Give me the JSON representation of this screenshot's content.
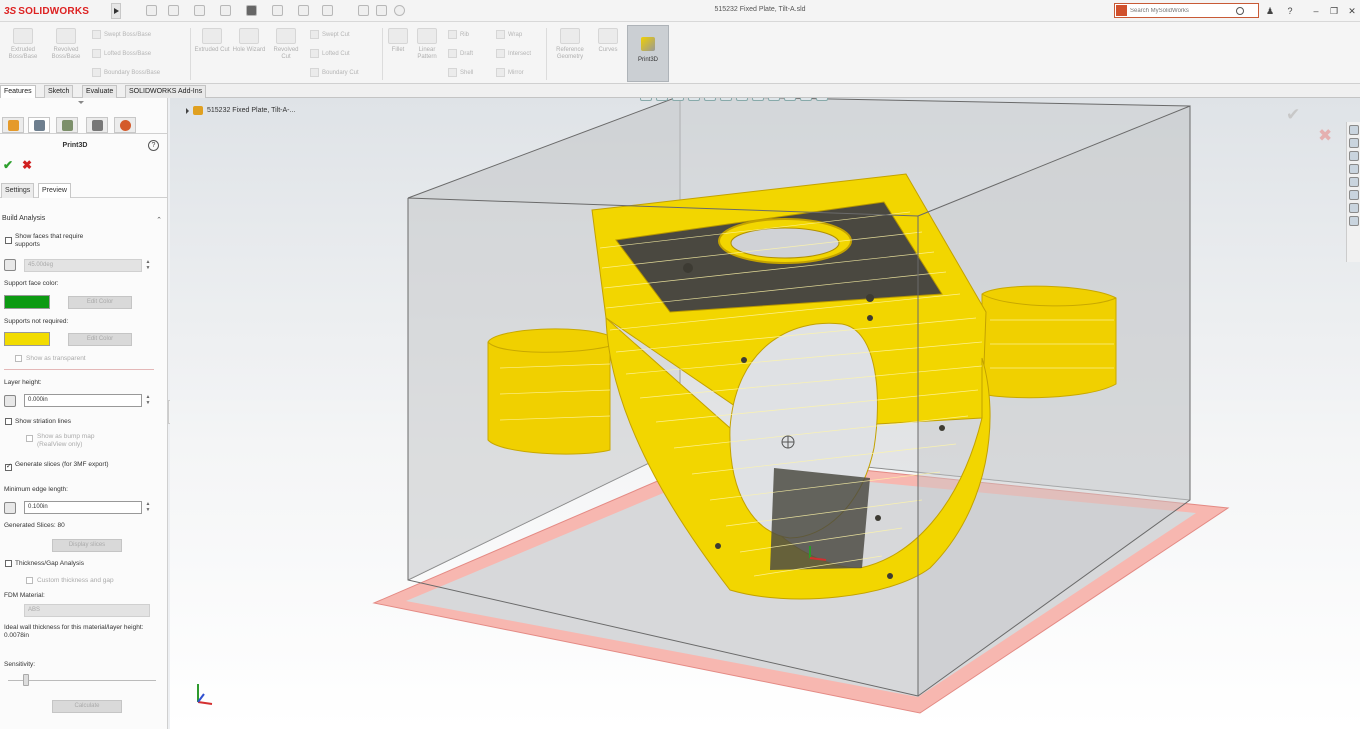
{
  "app": {
    "logo_ds": "3S",
    "logo_name": "SOLIDWORKS",
    "document_title": "515232 Fixed Plate, Tilt-A.sld",
    "search_placeholder": "Search MySolidWorks"
  },
  "command_manager": {
    "large_buttons": [
      {
        "id": "extruded-boss",
        "label": "Extruded Boss/Base"
      },
      {
        "id": "revolved-boss",
        "label": "Revolved Boss/Base"
      },
      {
        "id": "extruded-cut",
        "label": "Extruded Cut"
      },
      {
        "id": "hole-wizard",
        "label": "Hole Wizard"
      },
      {
        "id": "revolved-cut",
        "label": "Revolved Cut"
      },
      {
        "id": "fillet",
        "label": "Fillet"
      },
      {
        "id": "linear-pattern",
        "label": "Linear Pattern"
      },
      {
        "id": "reference-geometry",
        "label": "Reference Geometry"
      },
      {
        "id": "curves",
        "label": "Curves"
      }
    ],
    "small_buttons": [
      {
        "id": "swept-boss",
        "label": "Swept Boss/Base"
      },
      {
        "id": "lofted-boss",
        "label": "Lofted Boss/Base"
      },
      {
        "id": "boundary-boss",
        "label": "Boundary Boss/Base"
      },
      {
        "id": "swept-cut",
        "label": "Swept Cut"
      },
      {
        "id": "lofted-cut",
        "label": "Lofted Cut"
      },
      {
        "id": "boundary-cut",
        "label": "Boundary Cut"
      },
      {
        "id": "rib",
        "label": "Rib"
      },
      {
        "id": "draft",
        "label": "Draft"
      },
      {
        "id": "shell",
        "label": "Shell"
      },
      {
        "id": "wrap",
        "label": "Wrap"
      },
      {
        "id": "intersect",
        "label": "Intersect"
      },
      {
        "id": "mirror",
        "label": "Mirror"
      }
    ],
    "print3d_label": "Print3D"
  },
  "tabs": [
    "Features",
    "Sketch",
    "Evaluate",
    "SOLIDWORKS Add-Ins"
  ],
  "property_manager": {
    "title": "Print3D",
    "help": "?",
    "ok": "✔",
    "cancel": "✖",
    "sub_tabs": [
      "Settings",
      "Preview"
    ],
    "build_analysis": {
      "header": "Build Analysis",
      "show_faces_label": "Show faces that require supports",
      "angle_value": "45.00deg",
      "support_face_color_label": "Support face color:",
      "support_face_color": "#0c9a12",
      "edit_color_label": "Edit Color",
      "supports_not_required_label": "Supports not required:",
      "supports_not_required_color": "#f2dc00",
      "show_transparent_label": "Show as transparent",
      "layer_height_label": "Layer height:",
      "layer_height_value": "0.000in",
      "show_striation_label": "Show striation lines",
      "show_bump_map_label": "Show as bump map (RealView only)",
      "generate_slices_label": "Generate slices (for 3MF export)",
      "min_edge_label": "Minimum edge length:",
      "min_edge_value": "0.100in",
      "generated_slices_label": "Generated Slices: 80",
      "display_slices_label": "Display slices",
      "thickness_gap_label": "Thickness/Gap Analysis",
      "custom_thickness_label": "Custom thickness and gap",
      "fdm_material_label": "FDM Material:",
      "fdm_material_value": "ABS",
      "ideal_wall_label": "Ideal wall thickness for this material/layer height: 0.0078in",
      "sensitivity_label": "Sensitivity:",
      "sensitivity_value": 0.12,
      "calculate_label": "Calculate"
    }
  },
  "viewport": {
    "breadcrumb": "515232 Fixed Plate, Tilt-A-...",
    "confirm_ok": "✔",
    "confirm_cancel": "✖",
    "model_color": "#f5dc00",
    "build_plate_color": "#f08080"
  }
}
